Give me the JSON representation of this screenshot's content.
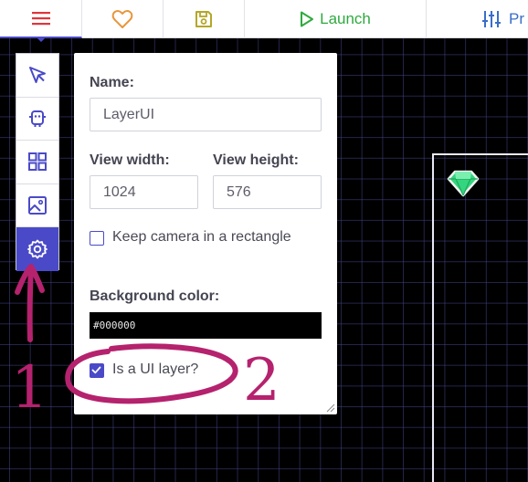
{
  "toolbar": {
    "launch_label": "Launch",
    "project_label": "Pr"
  },
  "palette": {
    "tools": [
      "select-tool",
      "copies-tool",
      "tiles-tool",
      "backgrounds-tool",
      "properties-tool"
    ],
    "active": "properties-tool"
  },
  "panel": {
    "name_label": "Name:",
    "name_value": "LayerUI",
    "view_width_label": "View width:",
    "view_width_value": "1024",
    "view_height_label": "View height:",
    "view_height_value": "576",
    "keep_camera_label": "Keep camera in a rectangle",
    "keep_camera_checked": false,
    "background_color_label": "Background color:",
    "background_color_value": "#000000",
    "is_ui_layer_label": "Is a UI layer?",
    "is_ui_layer_checked": true
  },
  "annotations": {
    "step_one": "1",
    "step_two": "2"
  },
  "colors": {
    "accent": "#4a4ac8",
    "launch": "#2eaa3e",
    "heart": "#e8963a",
    "save": "#b5a628",
    "menu": "#e0353a",
    "annotation": "#b5226e",
    "gem": "#3ce08a"
  }
}
